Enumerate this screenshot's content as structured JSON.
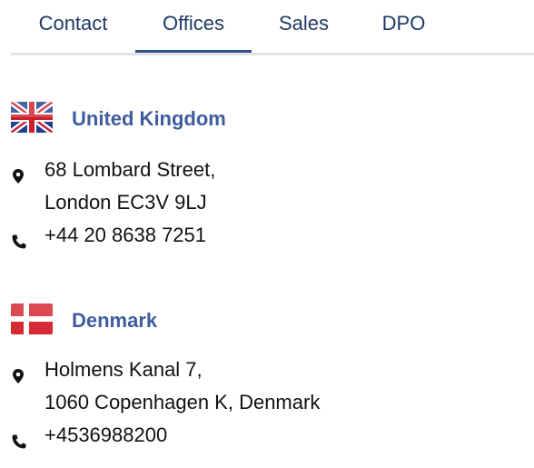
{
  "tabs": {
    "contact": "Contact",
    "offices": "Offices",
    "sales": "Sales",
    "dpo": "DPO"
  },
  "offices": [
    {
      "country": "United Kingdom",
      "flag": "uk-flag-icon",
      "address_line1": "68 Lombard Street,",
      "address_line2": "London EC3V 9LJ",
      "phone": "+44 20 8638 7251"
    },
    {
      "country": "Denmark",
      "flag": "denmark-flag-icon",
      "address_line1": "Holmens Kanal 7,",
      "address_line2": "1060 Copenhagen K, Denmark",
      "phone": "+4536988200"
    }
  ],
  "colors": {
    "tab_text": "#1f3a64",
    "tab_active_underline": "#2f4f8a",
    "country_text": "#3f5d9c",
    "body_text": "#111111",
    "divider": "#e3e3e3"
  }
}
